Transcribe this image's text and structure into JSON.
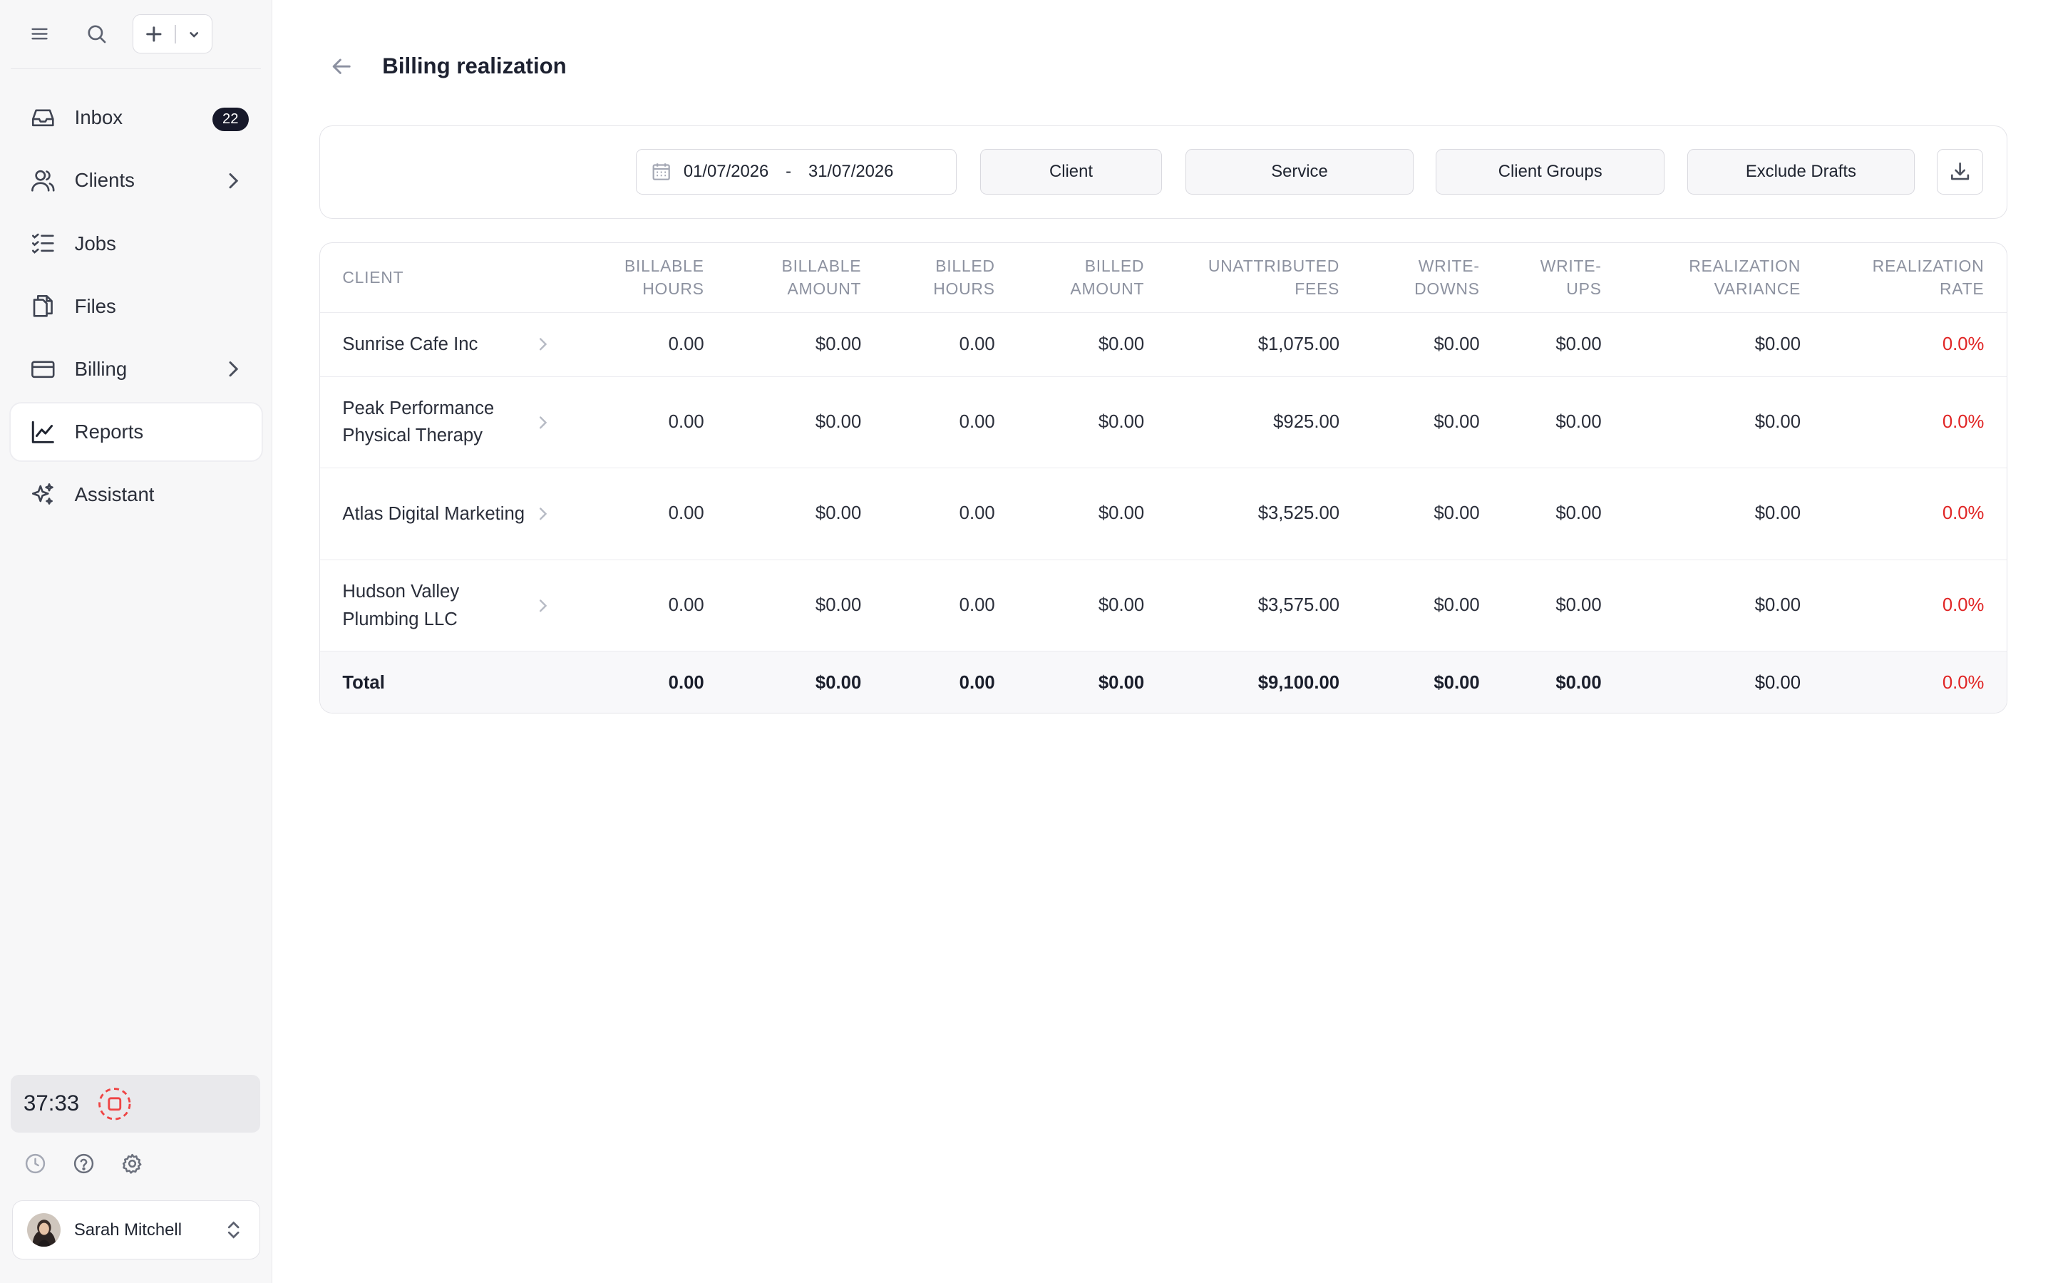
{
  "sidebar": {
    "nav": [
      {
        "label": "Inbox",
        "icon": "inbox-icon",
        "badge": "22"
      },
      {
        "label": "Clients",
        "icon": "users-icon"
      },
      {
        "label": "Jobs",
        "icon": "checklist-icon"
      },
      {
        "label": "Files",
        "icon": "files-icon"
      },
      {
        "label": "Billing",
        "icon": "credit-card-icon"
      },
      {
        "label": "Reports",
        "icon": "chart-line-icon",
        "active": true
      },
      {
        "label": "Assistant",
        "icon": "sparkles-icon"
      }
    ],
    "timer": "37:33",
    "user": {
      "name": "Sarah Mitchell"
    }
  },
  "page": {
    "title": "Billing realization"
  },
  "filters": {
    "date_start": "01/07/2026",
    "date_separator": "-",
    "date_end": "31/07/2026",
    "client": "Client",
    "service": "Service",
    "client_groups": "Client Groups",
    "exclude_drafts": "Exclude Drafts"
  },
  "table": {
    "columns": [
      {
        "line1": "Client",
        "line2": ""
      },
      {
        "line1": "Billable",
        "line2": "Hours"
      },
      {
        "line1": "Billable",
        "line2": "Amount"
      },
      {
        "line1": "Billed",
        "line2": "Hours"
      },
      {
        "line1": "Billed",
        "line2": "Amount"
      },
      {
        "line1": "Unattributed",
        "line2": "Fees"
      },
      {
        "line1": "Write-",
        "line2": "Downs"
      },
      {
        "line1": "Write-",
        "line2": "Ups"
      },
      {
        "line1": "Realization",
        "line2": "Variance"
      },
      {
        "line1": "Realization",
        "line2": "Rate"
      }
    ],
    "rows": [
      {
        "client": "Sunrise Cafe Inc",
        "billable_hours": "0.00",
        "billable_amount": "$0.00",
        "billed_hours": "0.00",
        "billed_amount": "$0.00",
        "unattributed_fees": "$1,075.00",
        "write_downs": "$0.00",
        "write_ups": "$0.00",
        "variance": "$0.00",
        "rate": "0.0%"
      },
      {
        "client": "Peak Performance Physical Therapy",
        "billable_hours": "0.00",
        "billable_amount": "$0.00",
        "billed_hours": "0.00",
        "billed_amount": "$0.00",
        "unattributed_fees": "$925.00",
        "write_downs": "$0.00",
        "write_ups": "$0.00",
        "variance": "$0.00",
        "rate": "0.0%"
      },
      {
        "client": "Atlas Digital Marketing",
        "billable_hours": "0.00",
        "billable_amount": "$0.00",
        "billed_hours": "0.00",
        "billed_amount": "$0.00",
        "unattributed_fees": "$3,525.00",
        "write_downs": "$0.00",
        "write_ups": "$0.00",
        "variance": "$0.00",
        "rate": "0.0%"
      },
      {
        "client": "Hudson Valley Plumbing LLC",
        "billable_hours": "0.00",
        "billable_amount": "$0.00",
        "billed_hours": "0.00",
        "billed_amount": "$0.00",
        "unattributed_fees": "$3,575.00",
        "write_downs": "$0.00",
        "write_ups": "$0.00",
        "variance": "$0.00",
        "rate": "0.0%"
      }
    ],
    "total": {
      "client": "Total",
      "billable_hours": "0.00",
      "billable_amount": "$0.00",
      "billed_hours": "0.00",
      "billed_amount": "$0.00",
      "unattributed_fees": "$9,100.00",
      "write_downs": "$0.00",
      "write_ups": "$0.00",
      "variance": "$0.00",
      "rate": "0.0%"
    }
  },
  "colors": {
    "negative_rate": "#e02424",
    "badge_bg": "#17192a",
    "timer_stop": "#ef4444"
  }
}
